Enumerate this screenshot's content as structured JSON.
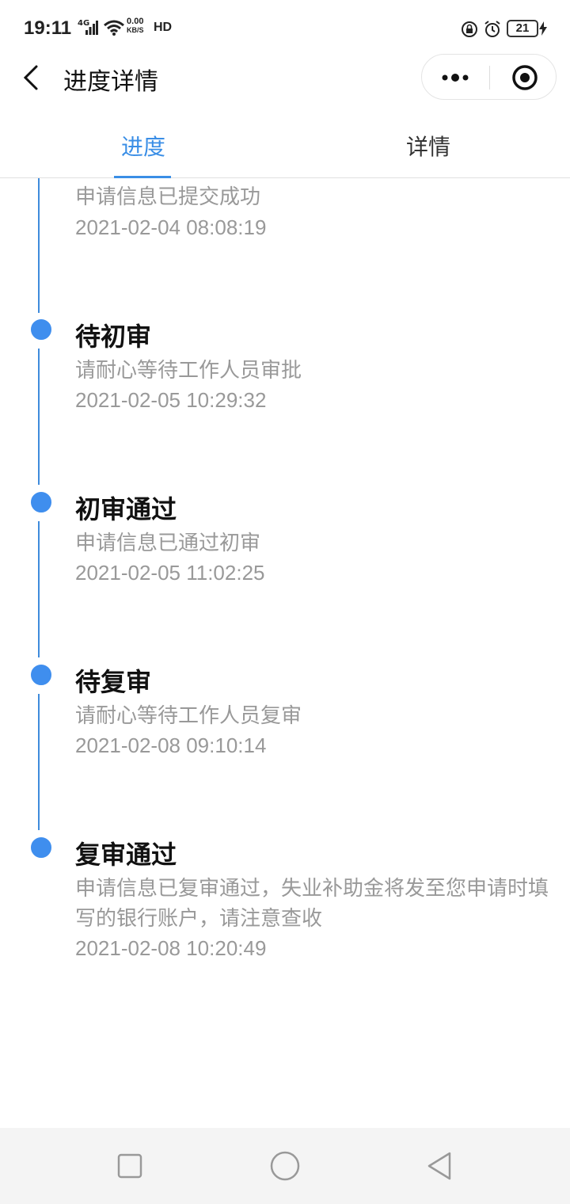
{
  "status_bar": {
    "time": "19:11",
    "network": "4G",
    "speed_value": "0.00",
    "speed_unit": "KB/S",
    "hd": "HD",
    "battery": "21"
  },
  "header": {
    "title": "进度详情"
  },
  "tabs": [
    {
      "label": "进度",
      "active": true
    },
    {
      "label": "详情",
      "active": false
    }
  ],
  "accent_color": "#3a8ee6",
  "timeline": [
    {
      "title": "",
      "desc": "申请信息已提交成功",
      "time": "2021-02-04 08:08:19"
    },
    {
      "title": "待初审",
      "desc": "请耐心等待工作人员审批",
      "time": "2021-02-05 10:29:32"
    },
    {
      "title": "初审通过",
      "desc": "申请信息已通过初审",
      "time": "2021-02-05 11:02:25"
    },
    {
      "title": "待复审",
      "desc": "请耐心等待工作人员复审",
      "time": "2021-02-08 09:10:14"
    },
    {
      "title": "复审通过",
      "desc": "申请信息已复审通过，失业补助金将发至您申请时填写的银行账户，请注意查收",
      "time": "2021-02-08 10:20:49"
    }
  ],
  "nav": {
    "recent_icon": "square-icon",
    "home_icon": "circle-icon",
    "back_icon": "triangle-back-icon"
  }
}
